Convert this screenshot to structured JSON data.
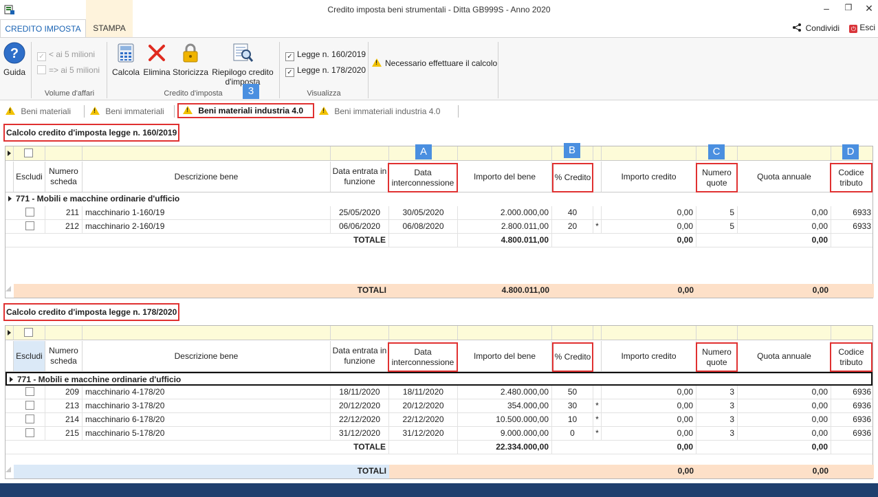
{
  "window": {
    "title": "Credito imposta beni strumentali -  Ditta GB999S - Anno 2020"
  },
  "ribbon_tabs": [
    {
      "label": "CREDITO IMPOSTA"
    },
    {
      "label": "STAMPA"
    }
  ],
  "top_actions": {
    "share": "Condividi",
    "exit": "Esci"
  },
  "ribbon": {
    "guida": "Guida",
    "volume": {
      "opt1": "< ai 5 milioni",
      "opt2": "=> ai 5 milioni",
      "group": "Volume d'affari"
    },
    "credito": {
      "calcola": "Calcola",
      "elimina": "Elimina",
      "storicizza": "Storicizza",
      "riepilogo1": "Riepilogo credito",
      "riepilogo2": "d'imposta",
      "group": "Credito d'imposta"
    },
    "visualizza": {
      "opt1": "Legge n. 160/2019",
      "opt2": "Legge n. 178/2020",
      "group": "Visualizza"
    },
    "warning": "Necessario effettuare il calcolo"
  },
  "badges": {
    "n3": "3",
    "A": "A",
    "B": "B",
    "C": "C",
    "D": "D"
  },
  "doc_tabs": [
    {
      "label": "Beni materiali"
    },
    {
      "label": "Beni immateriali"
    },
    {
      "label": "Beni materiali industria 4.0"
    },
    {
      "label": "Beni immateriali industria 4.0"
    }
  ],
  "headers": {
    "escludi": "Escludi",
    "numero1": "Numero",
    "numero2": "scheda",
    "descrizione": "Descrizione bene",
    "entrata1": "Data entrata in",
    "entrata2": "funzione",
    "inter1": "Data",
    "inter2": "interconnessione",
    "importo": "Importo del bene",
    "perc": "% Credito",
    "importo_credito": "Importo credito",
    "quote1": "Numero",
    "quote2": "quote",
    "quota_annuale": "Quota annuale",
    "codice1": "Codice",
    "codice2": "tributo"
  },
  "section1": {
    "title": "Calcolo credito d'imposta legge n. 160/2019",
    "group": "771 - Mobili e macchine ordinarie d'ufficio",
    "rows": [
      {
        "numero": "211",
        "descrizione": "macchinario 1-160/19",
        "entrata": "25/05/2020",
        "inter": "30/05/2020",
        "importo": "2.000.000,00",
        "perc": "40",
        "star": "",
        "credito": "0,00",
        "quote": "5",
        "quota": "0,00",
        "codice": "6933"
      },
      {
        "numero": "212",
        "descrizione": "macchinario 2-160/19",
        "entrata": "06/06/2020",
        "inter": "06/08/2020",
        "importo": "2.800.011,00",
        "perc": "20",
        "star": "*",
        "credito": "0,00",
        "quote": "5",
        "quota": "0,00",
        "codice": "6933"
      }
    ],
    "totale": {
      "label": "TOTALE",
      "importo": "4.800.011,00",
      "credito": "0,00",
      "quota": "0,00"
    },
    "totali": {
      "label": "TOTALI",
      "importo": "4.800.011,00",
      "credito": "0,00",
      "quota": "0,00"
    }
  },
  "section2": {
    "title": "Calcolo credito d'imposta legge n. 178/2020",
    "group": "771 - Mobili e macchine ordinarie d'ufficio",
    "rows": [
      {
        "numero": "209",
        "descrizione": "macchinario 4-178/20",
        "entrata": "18/11/2020",
        "inter": "18/11/2020",
        "importo": "2.480.000,00",
        "perc": "50",
        "star": "",
        "credito": "0,00",
        "quote": "3",
        "quota": "0,00",
        "codice": "6936"
      },
      {
        "numero": "213",
        "descrizione": "macchinario 3-178/20",
        "entrata": "20/12/2020",
        "inter": "20/12/2020",
        "importo": "354.000,00",
        "perc": "30",
        "star": "*",
        "credito": "0,00",
        "quote": "3",
        "quota": "0,00",
        "codice": "6936"
      },
      {
        "numero": "214",
        "descrizione": "macchinario 6-178/20",
        "entrata": "22/12/2020",
        "inter": "22/12/2020",
        "importo": "10.500.000,00",
        "perc": "10",
        "star": "*",
        "credito": "0,00",
        "quote": "3",
        "quota": "0,00",
        "codice": "6936"
      },
      {
        "numero": "215",
        "descrizione": "macchinario 5-178/20",
        "entrata": "31/12/2020",
        "inter": "31/12/2020",
        "importo": "9.000.000,00",
        "perc": "0",
        "star": "*",
        "credito": "0,00",
        "quote": "3",
        "quota": "0,00",
        "codice": "6936"
      }
    ],
    "totale": {
      "label": "TOTALE",
      "importo": "22.334.000,00",
      "credito": "0,00",
      "quota": "0,00"
    },
    "totali": {
      "label": "TOTALI",
      "credito": "0,00",
      "quota": "0,00"
    }
  },
  "colors": {
    "accent": "#1a63b3",
    "highlight": "#e03030",
    "totals": "#fde0c8",
    "filter": "#fdfbd8",
    "badge": "#4a8fe0"
  }
}
